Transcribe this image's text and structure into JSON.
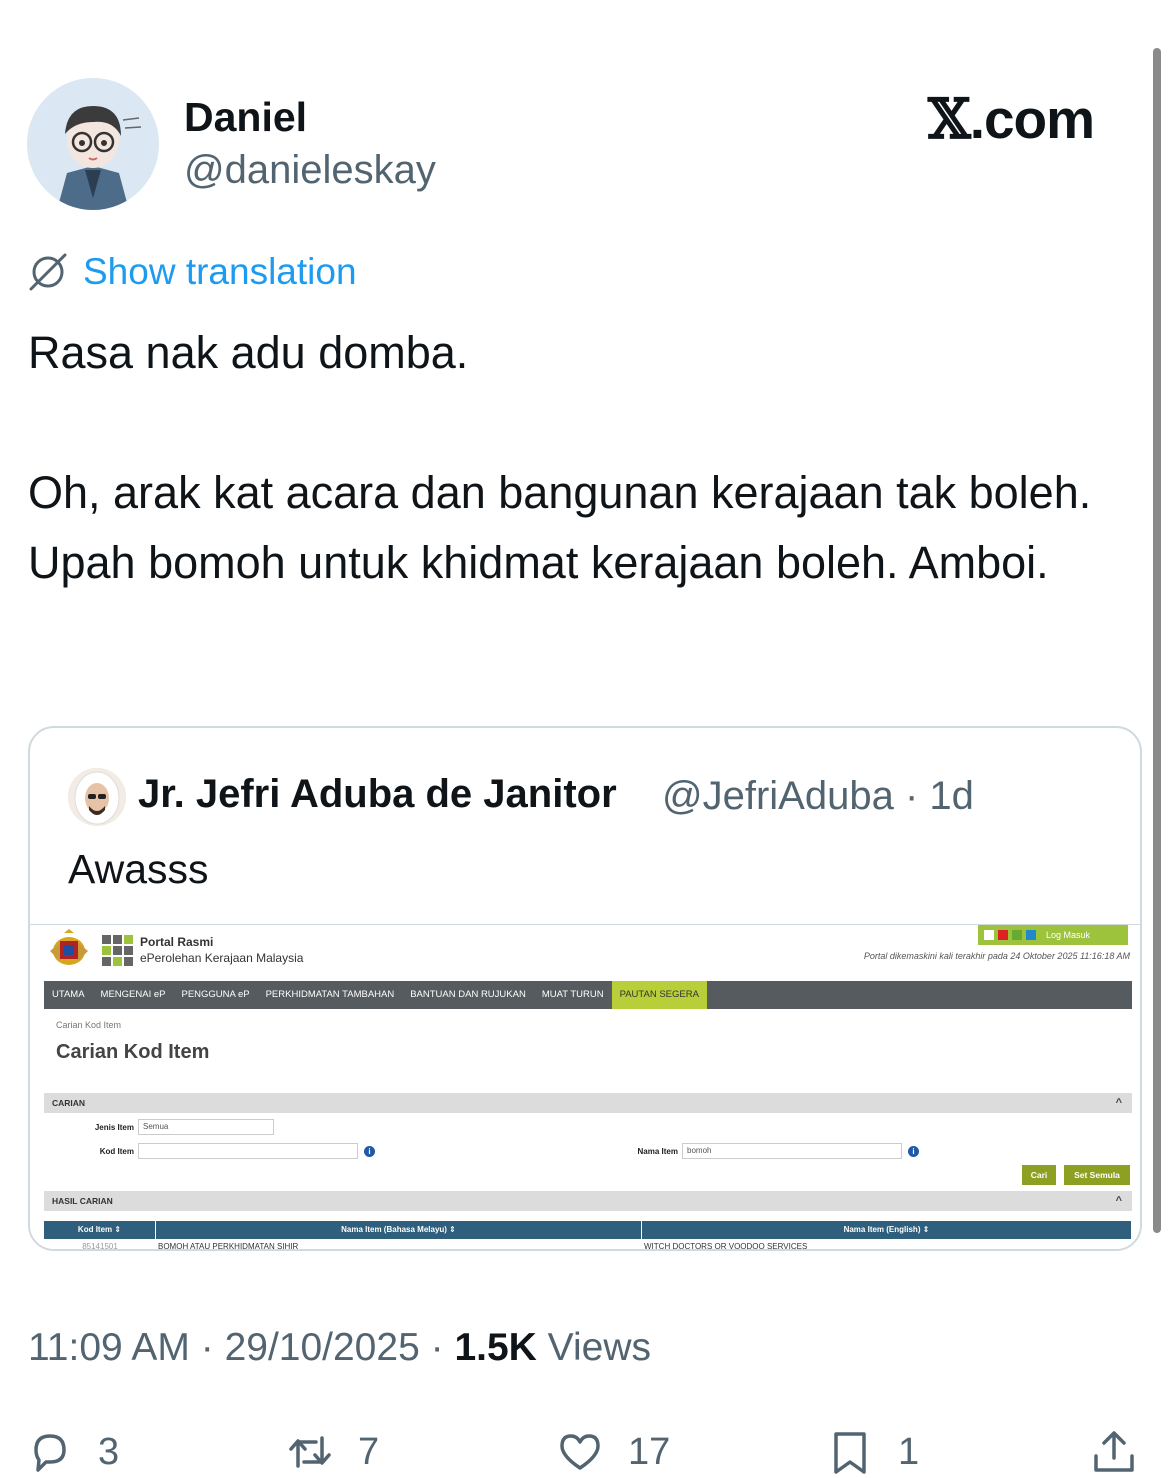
{
  "author": {
    "display_name": "Daniel",
    "handle": "@danieleskay"
  },
  "brand": {
    "x_mark": "𝕏",
    "suffix": ".com"
  },
  "translate_label": "Show translation",
  "tweet": {
    "paragraph1": "Rasa nak adu domba.",
    "paragraph2": "Oh, arak kat acara dan bangunan kerajaan tak boleh. Upah bomoh untuk khidmat kerajaan boleh. Amboi."
  },
  "quoted": {
    "display_name": "Jr. Jefri Aduba de Janitor",
    "handle_time": "@JefriAduba · 1d",
    "text": "Awasss",
    "portal": {
      "title": "Portal Rasmi",
      "subtitle": "ePerolehan Kerajaan Malaysia",
      "login_label": "Log Masuk",
      "updated": "Portal dikemaskini kali terakhir pada 24 Oktober 2025 11:16:18 AM",
      "nav": [
        "UTAMA",
        "MENGENAI eP",
        "PENGGUNA eP",
        "PERKHIDMATAN TAMBAHAN",
        "BANTUAN DAN RUJUKAN",
        "MUAT TURUN",
        "PAUTAN SEGERA"
      ],
      "breadcrumb": "Carian Kod Item",
      "heading": "Carian Kod Item",
      "section_search": "CARIAN",
      "label_jenis": "Jenis Item",
      "value_jenis": "Semua",
      "label_kod": "Kod Item",
      "value_kod": "",
      "label_nama": "Nama Item",
      "value_nama": "bomoh",
      "btn_search": "Cari",
      "btn_reset": "Set Semula",
      "section_results": "HASIL CARIAN",
      "columns": [
        "Kod Item ⇕",
        "Nama Item (Bahasa Melayu) ⇕",
        "Nama Item (English) ⇕"
      ],
      "rows": [
        [
          "85141501",
          "BOMOH ATAU PERKHIDMATAN SIHIR",
          "WITCH DOCTORS OR VOODOO SERVICES"
        ]
      ]
    }
  },
  "meta": {
    "time": "11:09 AM",
    "date": "29/10/2025",
    "views_count": "1.5K",
    "views_label": "Views"
  },
  "actions": {
    "replies": "3",
    "reposts": "7",
    "likes": "17",
    "bookmarks": "1"
  },
  "colors": {
    "link_blue": "#1d9bf0",
    "secondary_text": "#536471",
    "primary_text": "#0f1419",
    "border": "#cfd9de"
  }
}
